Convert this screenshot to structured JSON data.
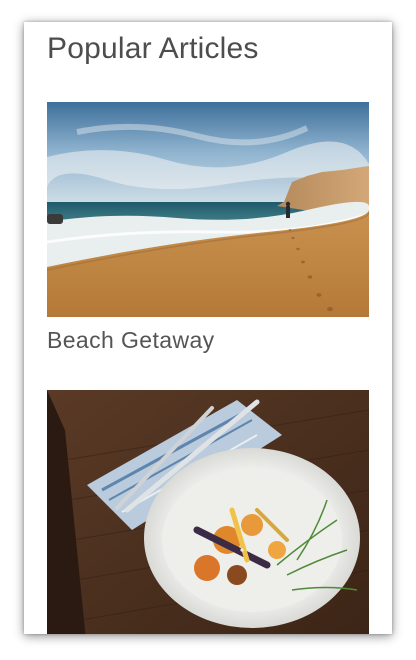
{
  "section": {
    "title": "Popular Articles"
  },
  "articles": [
    {
      "caption": "Beach Getaway",
      "image_icon": "beach-photo"
    },
    {
      "caption": "",
      "image_icon": "food-plate-photo"
    }
  ],
  "colors": {
    "title_text": "#4d4d4d",
    "caption_text": "#555555",
    "card_background": "#ffffff"
  }
}
